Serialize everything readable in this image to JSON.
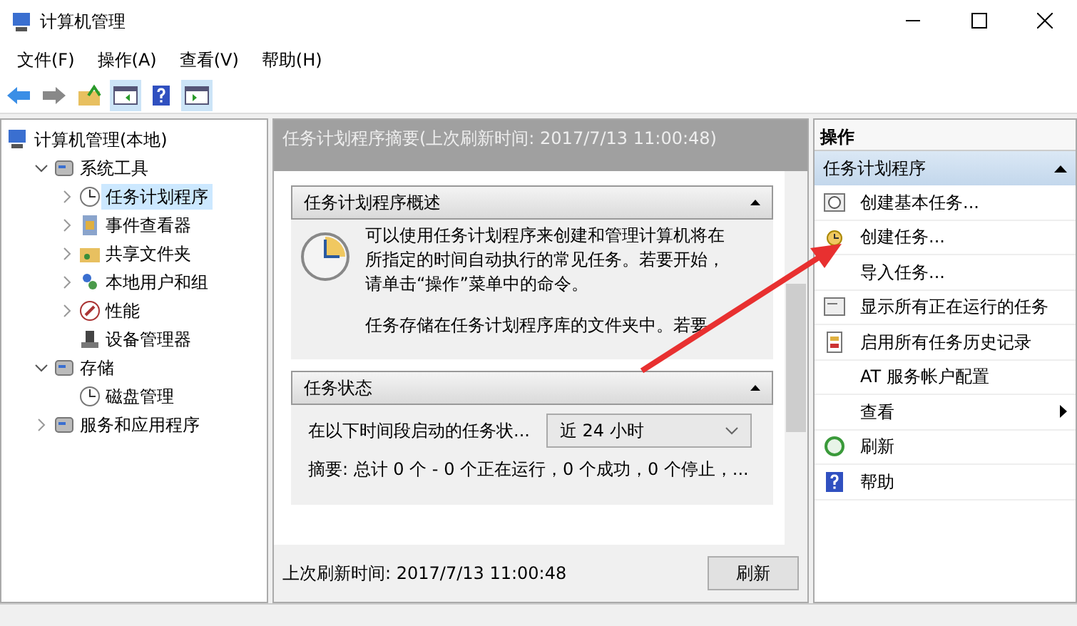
{
  "window": {
    "title": "计算机管理"
  },
  "menu": [
    {
      "label": "文件(F)"
    },
    {
      "label": "操作(A)"
    },
    {
      "label": "查看(V)"
    },
    {
      "label": "帮助(H)"
    }
  ],
  "tree": [
    {
      "label": "计算机管理(本地)",
      "selected": false,
      "children": [
        {
          "label": "系统工具",
          "selected": false,
          "expanded": true,
          "children": [
            {
              "label": "任务计划程序",
              "selected": true,
              "expanded": false
            },
            {
              "label": "事件查看器",
              "selected": false,
              "expanded": false
            },
            {
              "label": "共享文件夹",
              "selected": false,
              "expanded": false
            },
            {
              "label": "本地用户和组",
              "selected": false,
              "expanded": false
            },
            {
              "label": "性能",
              "selected": false,
              "expanded": false
            },
            {
              "label": "设备管理器",
              "selected": false
            }
          ]
        },
        {
          "label": "存储",
          "selected": false,
          "expanded": true,
          "children": [
            {
              "label": "磁盘管理",
              "selected": false
            }
          ]
        },
        {
          "label": "服务和应用程序",
          "selected": false,
          "expanded": false
        }
      ]
    }
  ],
  "summary": {
    "header": "任务计划程序摘要(上次刷新时间: 2017/7/13 11:00:48)",
    "overview": {
      "title": "任务计划程序概述",
      "expanded": true,
      "paragraphs": [
        "可以使用任务计划程序来创建和管理计算机将在所指定的时间自动执行的常见任务。若要开始，请单击“操作”菜单中的命令。",
        "任务存储在任务计划程序库的文件夹中。若要"
      ]
    },
    "status": {
      "title": "任务状态",
      "expanded": true,
      "label": "在以下时间段启动的任务状...",
      "period": "近 24 小时",
      "summary": "摘要: 总计 0 个 - 0 个正在运行，0 个成功，0 个停止，..."
    },
    "last_refresh": "上次刷新时间: 2017/7/13 11:00:48",
    "refresh_button": "刷新"
  },
  "actions": {
    "header": "操作",
    "group": {
      "title": "任务计划程序",
      "expanded": true
    },
    "items": [
      {
        "label": "创建基本任务...",
        "has_icon": true,
        "submenu": false
      },
      {
        "label": "创建任务...",
        "has_icon": true,
        "submenu": false
      },
      {
        "label": "导入任务...",
        "has_icon": false,
        "submenu": false
      },
      {
        "label": "显示所有正在运行的任务",
        "has_icon": true,
        "submenu": false
      },
      {
        "label": "启用所有任务历史记录",
        "has_icon": true,
        "submenu": false
      },
      {
        "label": "AT 服务帐户配置",
        "has_icon": false,
        "submenu": false
      },
      {
        "label": "查看",
        "has_icon": false,
        "submenu": true
      },
      {
        "label": "刷新",
        "has_icon": true,
        "submenu": false
      },
      {
        "label": "帮助",
        "has_icon": true,
        "submenu": false
      }
    ]
  }
}
